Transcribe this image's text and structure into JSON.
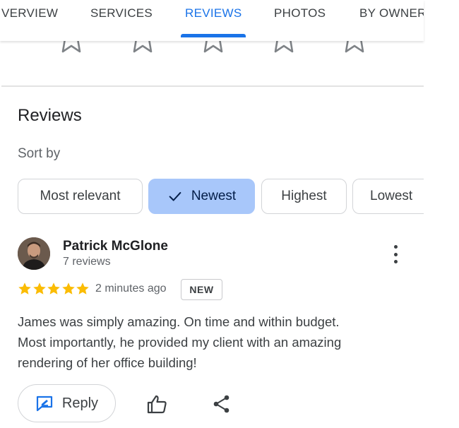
{
  "tabs": [
    {
      "label": "VERVIEW",
      "active": false
    },
    {
      "label": "SERVICES",
      "active": false
    },
    {
      "label": "REVIEWS",
      "active": true
    },
    {
      "label": "PHOTOS",
      "active": false
    },
    {
      "label": "BY OWNER",
      "active": false
    }
  ],
  "reviews": {
    "title": "Reviews",
    "sort_label": "Sort by",
    "sort_options": [
      "Most relevant",
      "Newest",
      "Highest",
      "Lowest"
    ],
    "selected_sort": "Newest"
  },
  "review": {
    "name": "Patrick McGlone",
    "count": "7 reviews",
    "stars": 5,
    "time": "2 minutes ago",
    "badge": "NEW",
    "text_lines": [
      "James was simply amazing. On time and within budget.",
      "Most importantly, he provided my client with an amazing",
      "rendering of her office building!"
    ]
  },
  "actions": {
    "reply": "Reply"
  },
  "colors": {
    "accent": "#1a73e8",
    "selected_chip": "#a8c7fa",
    "star": "#fbbc04"
  },
  "icons": [
    "check-icon",
    "more-vert-icon",
    "star-icon",
    "reply-icon",
    "thumb-up-icon",
    "share-icon"
  ]
}
